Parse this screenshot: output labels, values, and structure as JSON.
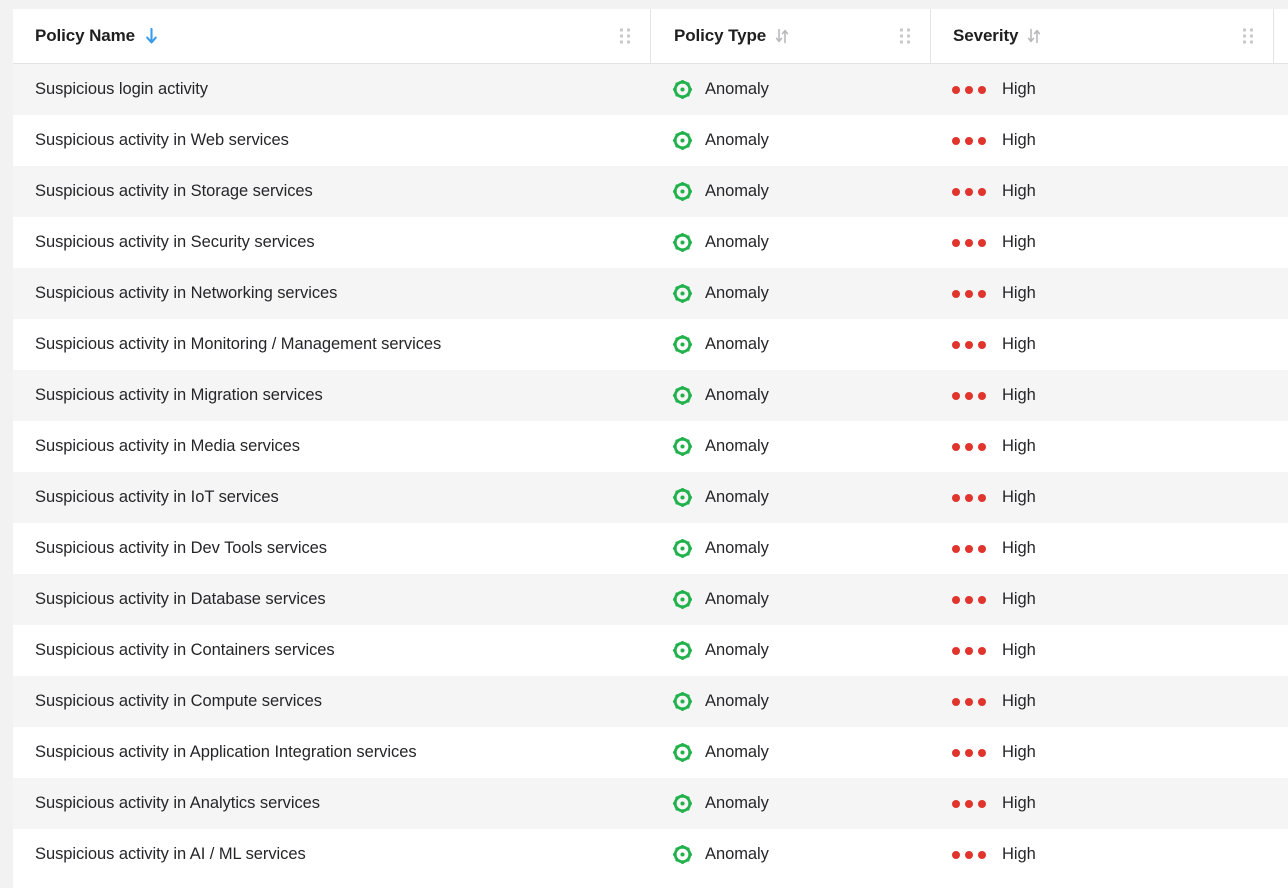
{
  "colors": {
    "accent_sort": "#3a9bed",
    "anomaly_icon": "#22b24c",
    "severity_dot": "#e0342c",
    "header_text": "#1f1f1f",
    "cell_text": "#262629",
    "stripe": "#f5f5f6",
    "border": "#e3e3e5",
    "page_background": "#f2f2f3"
  },
  "table": {
    "columns": [
      {
        "key": "policy_name",
        "label": "Policy Name",
        "sort_icon": "arrow-down-icon",
        "sort_state": "descending",
        "grip_icon": "drag-handle-icon"
      },
      {
        "key": "policy_type",
        "label": "Policy Type",
        "sort_icon": "sort-updown-icon",
        "sort_state": "unsorted",
        "grip_icon": "drag-handle-icon"
      },
      {
        "key": "severity",
        "label": "Severity",
        "sort_icon": "sort-updown-icon",
        "sort_state": "unsorted",
        "grip_icon": "drag-handle-icon"
      }
    ],
    "rows": [
      {
        "policy_name": "Suspicious login activity",
        "policy_type": "Anomaly",
        "policy_type_icon": "anomaly-atom-icon",
        "severity": "High",
        "severity_dots": 3
      },
      {
        "policy_name": "Suspicious activity in Web services",
        "policy_type": "Anomaly",
        "policy_type_icon": "anomaly-atom-icon",
        "severity": "High",
        "severity_dots": 3
      },
      {
        "policy_name": "Suspicious activity in Storage services",
        "policy_type": "Anomaly",
        "policy_type_icon": "anomaly-atom-icon",
        "severity": "High",
        "severity_dots": 3
      },
      {
        "policy_name": "Suspicious activity in Security services",
        "policy_type": "Anomaly",
        "policy_type_icon": "anomaly-atom-icon",
        "severity": "High",
        "severity_dots": 3
      },
      {
        "policy_name": "Suspicious activity in Networking services",
        "policy_type": "Anomaly",
        "policy_type_icon": "anomaly-atom-icon",
        "severity": "High",
        "severity_dots": 3
      },
      {
        "policy_name": "Suspicious activity in Monitoring / Management services",
        "policy_type": "Anomaly",
        "policy_type_icon": "anomaly-atom-icon",
        "severity": "High",
        "severity_dots": 3
      },
      {
        "policy_name": "Suspicious activity in Migration services",
        "policy_type": "Anomaly",
        "policy_type_icon": "anomaly-atom-icon",
        "severity": "High",
        "severity_dots": 3
      },
      {
        "policy_name": "Suspicious activity in Media services",
        "policy_type": "Anomaly",
        "policy_type_icon": "anomaly-atom-icon",
        "severity": "High",
        "severity_dots": 3
      },
      {
        "policy_name": "Suspicious activity in IoT services",
        "policy_type": "Anomaly",
        "policy_type_icon": "anomaly-atom-icon",
        "severity": "High",
        "severity_dots": 3
      },
      {
        "policy_name": "Suspicious activity in Dev Tools services",
        "policy_type": "Anomaly",
        "policy_type_icon": "anomaly-atom-icon",
        "severity": "High",
        "severity_dots": 3
      },
      {
        "policy_name": "Suspicious activity in Database services",
        "policy_type": "Anomaly",
        "policy_type_icon": "anomaly-atom-icon",
        "severity": "High",
        "severity_dots": 3
      },
      {
        "policy_name": "Suspicious activity in Containers services",
        "policy_type": "Anomaly",
        "policy_type_icon": "anomaly-atom-icon",
        "severity": "High",
        "severity_dots": 3
      },
      {
        "policy_name": "Suspicious activity in Compute services",
        "policy_type": "Anomaly",
        "policy_type_icon": "anomaly-atom-icon",
        "severity": "High",
        "severity_dots": 3
      },
      {
        "policy_name": "Suspicious activity in Application Integration services",
        "policy_type": "Anomaly",
        "policy_type_icon": "anomaly-atom-icon",
        "severity": "High",
        "severity_dots": 3
      },
      {
        "policy_name": "Suspicious activity in Analytics services",
        "policy_type": "Anomaly",
        "policy_type_icon": "anomaly-atom-icon",
        "severity": "High",
        "severity_dots": 3
      },
      {
        "policy_name": "Suspicious activity in AI / ML services",
        "policy_type": "Anomaly",
        "policy_type_icon": "anomaly-atom-icon",
        "severity": "High",
        "severity_dots": 3
      }
    ]
  }
}
